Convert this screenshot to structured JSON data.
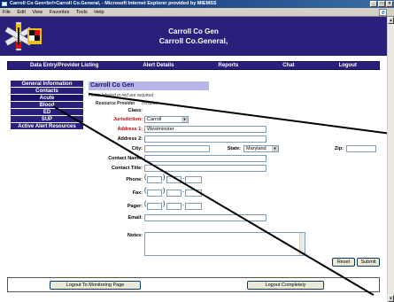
{
  "window": {
    "title": "Carroll Co Gen<br/>Carroll Co.General, - Microsoft Internet Explorer provided by MIEMSS",
    "buttons": [
      "_",
      "□",
      "×"
    ]
  },
  "menu": [
    "File",
    "Edit",
    "View",
    "Favorites",
    "Tools",
    "Help"
  ],
  "banner": {
    "line1": "Carroll Co Gen",
    "line2": "Carroll Co.General,"
  },
  "nav": [
    "Data Entry/Provider Listing",
    "Alert Details",
    "Reports",
    "Chat",
    "Logout"
  ],
  "sidebar": [
    "General Information",
    "Contacts",
    "Acute",
    "Blood",
    "ED",
    "SUP",
    "Active Alert Resources"
  ],
  "form": {
    "title": "Carroll Co Gen",
    "required_note": "Fields labeled in red are required",
    "section_label": "Resource Provider",
    "section_value": "Hospital",
    "class_label": "Class:",
    "jurisdiction_label": "Jurisdiction:",
    "jurisdiction_value": "Carroll",
    "address1_label": "Address 1:",
    "address1_value": "Westminster",
    "address2_label": "Address 2:",
    "city_label": "City:",
    "state_label": "State:",
    "state_value": "Maryland",
    "zip_label": "Zip:",
    "contact_name_label": "Contact Name:",
    "contact_title_label": "Contact Title:",
    "phone_label": "Phone:",
    "fax_label": "Fax:",
    "pager_label": "Pager:",
    "email_label": "Email:",
    "notes_label": "Notes:",
    "reset_label": "Reset",
    "submit_label": "Submit"
  },
  "footer": {
    "monitoring_label": "Logout To Monitoring Page",
    "complete_label": "Logout Completely"
  }
}
